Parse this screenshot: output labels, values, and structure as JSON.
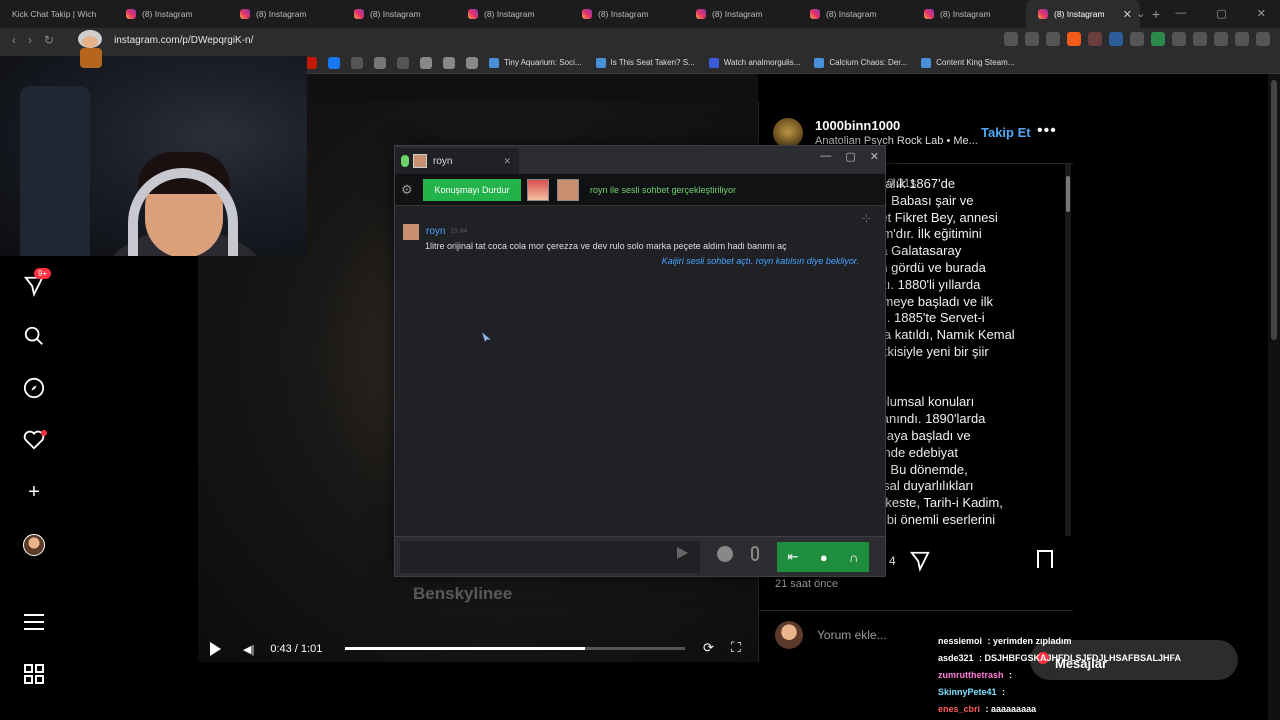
{
  "browser": {
    "tabs": [
      {
        "label": "Kick Chat Takip | Wich",
        "favicon": "kick-icon"
      },
      {
        "label": "(8) Instagram",
        "favicon": "instagram-icon"
      },
      {
        "label": "(8) Instagram",
        "favicon": "instagram-icon"
      },
      {
        "label": "(8) Instagram",
        "favicon": "instagram-icon"
      },
      {
        "label": "(8) Instagram",
        "favicon": "instagram-icon"
      },
      {
        "label": "(8) Instagram",
        "favicon": "instagram-icon"
      },
      {
        "label": "(8) Instagram",
        "favicon": "instagram-icon"
      },
      {
        "label": "(8) Instagram",
        "favicon": "instagram-icon"
      },
      {
        "label": "(8) Instagram",
        "favicon": "instagram-icon"
      },
      {
        "label": "(8) Instagram",
        "favicon": "instagram-icon"
      }
    ],
    "url": "instagram.com/p/DWepqrgiK-n/",
    "bookmarks": [
      "Tiny Aquarium: Soci...",
      "Is This Seat Taken? S...",
      "Watch analmorgulis...",
      "Calcium Chaos: Der...",
      "Content King Steam..."
    ]
  },
  "post": {
    "username": "1000binn1000",
    "subtitle": "Anatolian Psych Rock Lab • Me...",
    "follow_label": "Takip Et",
    "comment_meta": "0 21s",
    "caption_lines": [
      "24 Aralık 1867'de",
      "oğdu. Babası şair ve",
      "ehmet Fikret Bey, annesi",
      " Hanım'dır. İlk eğitimini",
      " sonra Galatasaray",
      "renim gördü ve burada",
      "tanıştı. 1880'li yıllarda",
      "ğilenmeye başladı ve ilk",
      "mladı. 1885'te Servet-i",
      "uğuna katıldı, Namık Kemal",
      "nın etkisiyle yeni bir şiir",
      "irdi.",
      "",
      "le toplumsal konuları",
      "iyle tanındı. 1890'larda",
      "yapmaya başladı ve",
      "isesi'nde edebiyat",
      "yaptı. Bu dönemde,",
      "plumsal duyarlılıkları",
      "o-ı Şikeste, Tarih-i Kadim,",
      "teri gibi önemli eserlerini"
    ],
    "likes_partial": "4",
    "time_ago": "21 saat önce",
    "comment_placeholder": "Yorum ekle..."
  },
  "video": {
    "time": "0:43 / 1:01",
    "progress": 0.705,
    "watermark": "Benskylinee"
  },
  "sidebar": {
    "notif_badge": "9+"
  },
  "chat_window": {
    "tab_name": "royn",
    "stop_button": "Konuşmayı Durdur",
    "voice_status": "royn ile sesli sohbet gerçekleştiriliyor",
    "message": {
      "user": "royn",
      "time": "19:44",
      "text": "1litre orijinal tat coca cola mor çerezza ve dev rulo solo marka peçete aldım hadi banımı aç"
    },
    "system_message": "Kaijiri sesli sohbet açtı. royn katılsın diye bekliyor."
  },
  "kick_chat": {
    "messages": [
      {
        "user": "nessiemoi",
        "text": "yerimden zıpladım",
        "color": "#ffffff"
      },
      {
        "user": "asde321",
        "text": "DSJHBFGSKAJHFDLSJFDJLHSAFBSALJHFA",
        "color": "#ffffff"
      },
      {
        "user": "zumrutthetrash",
        "text": "",
        "color": "#ff7ad9"
      },
      {
        "user": "SkinnyPete41",
        "text": "",
        "color": "#7ee0ff"
      },
      {
        "user": "enes_cbri",
        "text": "aaaaaaaaa",
        "color": "#ff5a5a"
      }
    ],
    "dm_label": "Mesajlar"
  }
}
